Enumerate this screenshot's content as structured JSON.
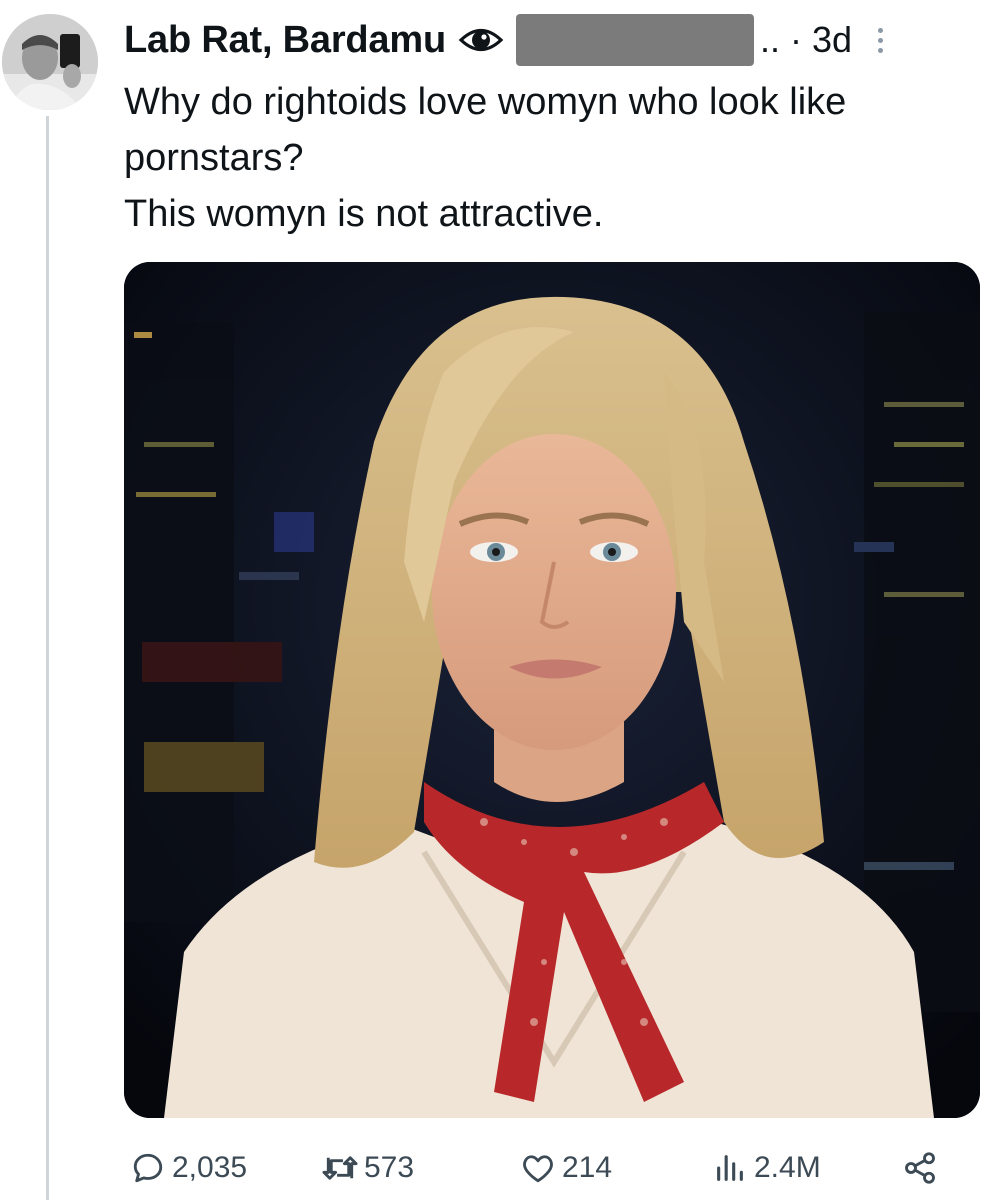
{
  "author": {
    "display_name": "Lab Rat, Bardamu",
    "badge_icon": "eye-icon",
    "handle_redacted": true,
    "ellipsis": "..",
    "separator": "·",
    "time": "3d"
  },
  "tweet": {
    "lines": [
      "Why do rightoids love womyn who look like pornstars?",
      "This womyn is not attractive."
    ],
    "media": {
      "kind": "photo",
      "description_icon": "photo-portrait"
    }
  },
  "actions": {
    "replies": "2,035",
    "reposts": "573",
    "likes": "214",
    "views": "2.4M"
  },
  "colors": {
    "text": "#0f1419",
    "muted": "#3c4a55",
    "thread_line": "#cfd5d9",
    "redaction": "#7b7b7b"
  }
}
